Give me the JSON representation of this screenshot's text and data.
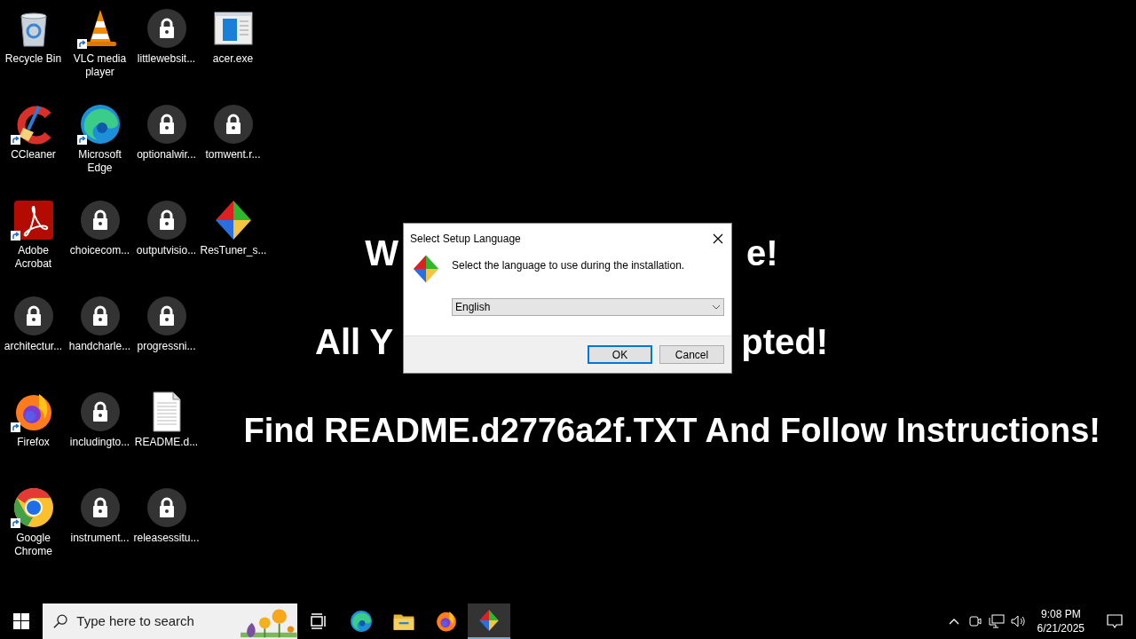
{
  "desktop": {
    "icons": [
      {
        "label": "Recycle Bin",
        "kind": "recycle",
        "shortcut": false
      },
      {
        "label": "CCleaner",
        "kind": "ccleaner",
        "shortcut": true
      },
      {
        "label": "Adobe Acrobat",
        "kind": "pdf",
        "shortcut": true
      },
      {
        "label": "architectur...",
        "kind": "lock",
        "shortcut": false
      },
      {
        "label": "Firefox",
        "kind": "firefox",
        "shortcut": true
      },
      {
        "label": "Google Chrome",
        "kind": "chrome",
        "shortcut": true
      },
      {
        "label": "VLC media player",
        "kind": "vlc",
        "shortcut": true
      },
      {
        "label": "Microsoft Edge",
        "kind": "edge",
        "shortcut": true
      },
      {
        "label": "choicecom...",
        "kind": "lock",
        "shortcut": false
      },
      {
        "label": "handcharle...",
        "kind": "lock",
        "shortcut": false
      },
      {
        "label": "includingto...",
        "kind": "lock",
        "shortcut": false
      },
      {
        "label": "instrument...",
        "kind": "lock",
        "shortcut": false
      },
      {
        "label": "littlewebsit...",
        "kind": "lock",
        "shortcut": false
      },
      {
        "label": "optionalwir...",
        "kind": "lock",
        "shortcut": false
      },
      {
        "label": "outputvisio...",
        "kind": "lock",
        "shortcut": false
      },
      {
        "label": "progressni...",
        "kind": "lock",
        "shortcut": false
      },
      {
        "label": "README.d...",
        "kind": "document",
        "shortcut": false
      },
      {
        "label": "releasessitu...",
        "kind": "lock",
        "shortcut": false
      },
      {
        "label": "acer.exe",
        "kind": "window",
        "shortcut": false
      },
      {
        "label": "tomwent.r...",
        "kind": "lock",
        "shortcut": false
      },
      {
        "label": "ResTuner_s...",
        "kind": "restuner",
        "shortcut": false
      }
    ]
  },
  "wallpaper": {
    "lines": [
      {
        "kind": "split",
        "left": "W",
        "right": "e!"
      },
      {
        "kind": "split",
        "left": "All Y",
        "right": "pted!"
      },
      {
        "kind": "full",
        "text": "Find README.d2776a2f.TXT And Follow Instructions!"
      }
    ]
  },
  "dialog": {
    "title": "Select Setup Language",
    "message": "Select the language to use during the installation.",
    "language": {
      "value": "English"
    },
    "buttons": [
      {
        "label": "OK",
        "default": true
      },
      {
        "label": "Cancel",
        "default": false
      }
    ]
  },
  "taskbar": {
    "search": {
      "placeholder": "Type here to search"
    },
    "apps": [
      {
        "kind": "edge",
        "active": false
      },
      {
        "kind": "explorer",
        "active": false
      },
      {
        "kind": "firefox",
        "active": false
      },
      {
        "kind": "restuner",
        "active": true
      }
    ],
    "clock": {
      "time": "9:08 PM",
      "date": "6/21/2025"
    }
  }
}
